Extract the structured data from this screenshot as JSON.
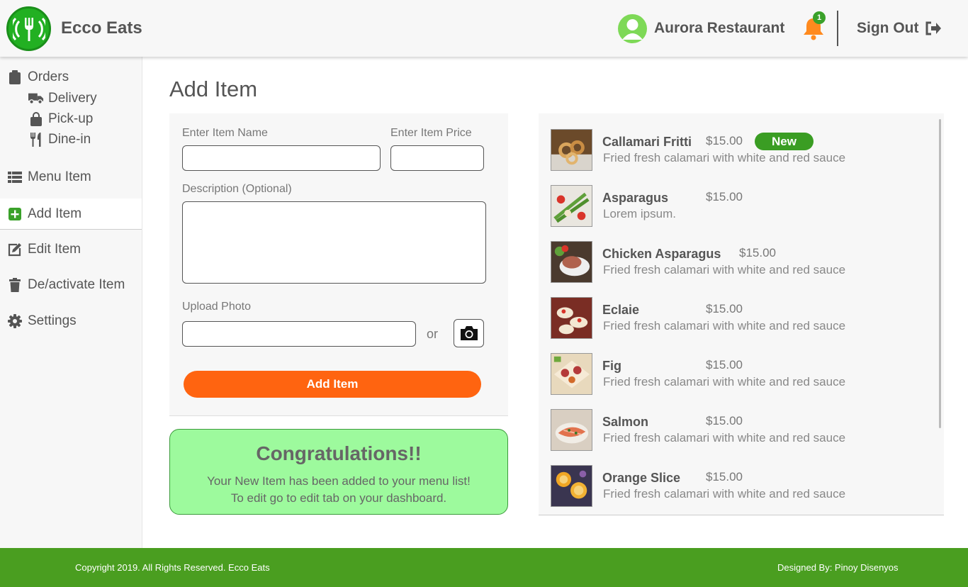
{
  "header": {
    "brand": "Ecco Eats",
    "logo_icon": "fork-icon",
    "restaurant_name": "Aurora Restaurant",
    "notification_count": "1",
    "signout_label": "Sign Out"
  },
  "sidebar": {
    "orders": "Orders",
    "sub_items": [
      {
        "label": "Delivery",
        "icon": "truck-icon"
      },
      {
        "label": "Pick-up",
        "icon": "shopping-bag-icon"
      },
      {
        "label": "Dine-in",
        "icon": "utensils-icon"
      }
    ],
    "items": [
      {
        "label": "Menu Item",
        "icon": "list-icon"
      },
      {
        "label": "Add Item",
        "icon": "plus-square-icon",
        "active": true
      },
      {
        "label": "Edit Item",
        "icon": "edit-icon"
      },
      {
        "label": "De/activate Item",
        "icon": "trash-icon"
      },
      {
        "label": "Settings",
        "icon": "gear-icon"
      }
    ]
  },
  "form": {
    "page_title": "Add Item",
    "name_label": "Enter Item Name",
    "price_label": "Enter Item Price",
    "description_label": "Description (Optional)",
    "upload_label": "Upload Photo",
    "name_value": "",
    "price_value": "",
    "description_value": "",
    "upload_value": "",
    "or_text": "or",
    "submit_label": "Add Item"
  },
  "congrats": {
    "title": "Congratulations!!",
    "line1": "Your New Item has been added to your menu list!",
    "line2": "To edit go to edit tab on your dashboard."
  },
  "menu_items": [
    {
      "name": "Callamari Fritti",
      "price": "$15.00",
      "desc": "Fried fresh calamari with white and red sauce",
      "badge": "New"
    },
    {
      "name": "Asparagus",
      "price": "$15.00",
      "desc": "Lorem ipsum."
    },
    {
      "name": "Chicken Asparagus",
      "price": "$15.00",
      "desc": "Fried fresh calamari with white and red sauce"
    },
    {
      "name": "Eclaie",
      "price": "$15.00",
      "desc": "Fried fresh calamari with white and red sauce"
    },
    {
      "name": "Fig",
      "price": "$15.00",
      "desc": "Fried fresh calamari with white and red sauce"
    },
    {
      "name": "Salmon",
      "price": "$15.00",
      "desc": "Fried fresh calamari with white and red sauce"
    },
    {
      "name": "Orange Slice",
      "price": "$15.00",
      "desc": "Fried fresh calamari with white and red sauce"
    }
  ],
  "footer": {
    "copyright": "Copyright 2019. All Rights Reserved. Ecco Eats",
    "designer": "Designed By: Pinoy Disenyos"
  },
  "colors": {
    "accent_orange": "#ff6410",
    "brand_green": "#4a9e20",
    "success_bg": "#9dfa9d"
  }
}
